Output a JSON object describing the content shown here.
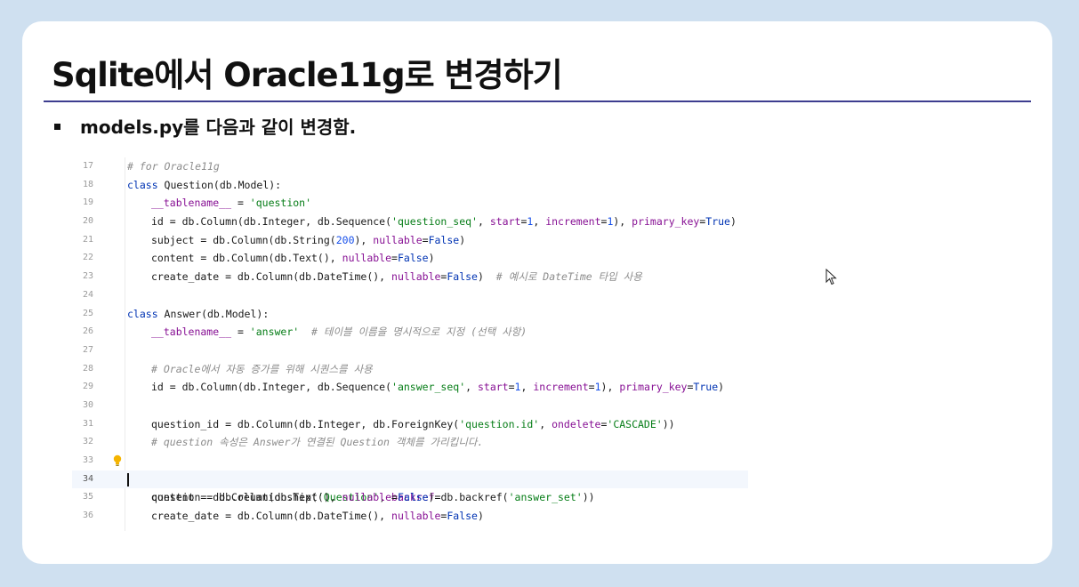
{
  "slide": {
    "title": "Sqlite에서 Oracle11g로 변경하기",
    "bullet": "models.py를 다음과 같이 변경함."
  },
  "code": {
    "current_line": 34,
    "lines": [
      {
        "n": "17",
        "text": "# for Oracle11g"
      },
      {
        "n": "18",
        "text": "class Question(db.Model):"
      },
      {
        "n": "19",
        "text": "__tablename__ = 'question'"
      },
      {
        "n": "20",
        "text": "id = db.Column(db.Integer, db.Sequence('question_seq', start=1, increment=1), primary_key=True)"
      },
      {
        "n": "21",
        "text": "subject = db.Column(db.String(200), nullable=False)"
      },
      {
        "n": "22",
        "text": "content = db.Column(db.Text(), nullable=False)"
      },
      {
        "n": "23",
        "text": "create_date = db.Column(db.DateTime(), nullable=False)  # 예시로 DateTime 타입 사용"
      },
      {
        "n": "24",
        "text": ""
      },
      {
        "n": "25",
        "text": "class Answer(db.Model):"
      },
      {
        "n": "26",
        "text": "__tablename__ = 'answer'  # 테이블 이름을 명시적으로 지정 (선택 사항)"
      },
      {
        "n": "27",
        "text": ""
      },
      {
        "n": "28",
        "text": "# Oracle에서 자동 증가를 위해 시퀀스를 사용"
      },
      {
        "n": "29",
        "text": "id = db.Column(db.Integer, db.Sequence('answer_seq', start=1, increment=1), primary_key=True)"
      },
      {
        "n": "30",
        "text": ""
      },
      {
        "n": "31",
        "text": "question_id = db.Column(db.Integer, db.ForeignKey('question.id', ondelete='CASCADE'))"
      },
      {
        "n": "32",
        "text": "# question 속성은 Answer가 연결된 Question 객체를 가리킵니다."
      },
      {
        "n": "33",
        "text": "question = db.relationship('Question', backref=db.backref('answer_set'))"
      },
      {
        "n": "34",
        "text": ""
      },
      {
        "n": "35",
        "text": "content = db.Column(db.Text(), nullable=False)"
      },
      {
        "n": "36",
        "text": "create_date = db.Column(db.DateTime(), nullable=False)"
      }
    ]
  },
  "icons": {
    "gutter_icon": "lightbulb-icon",
    "pointer": "mouse-cursor-icon"
  },
  "colors": {
    "background": "#cfe0f0",
    "title_rule": "#3d3d8f",
    "keyword": "#0033b3",
    "string": "#067d17",
    "number": "#1750eb",
    "parameter": "#871094",
    "comment": "#8c8c8c"
  }
}
